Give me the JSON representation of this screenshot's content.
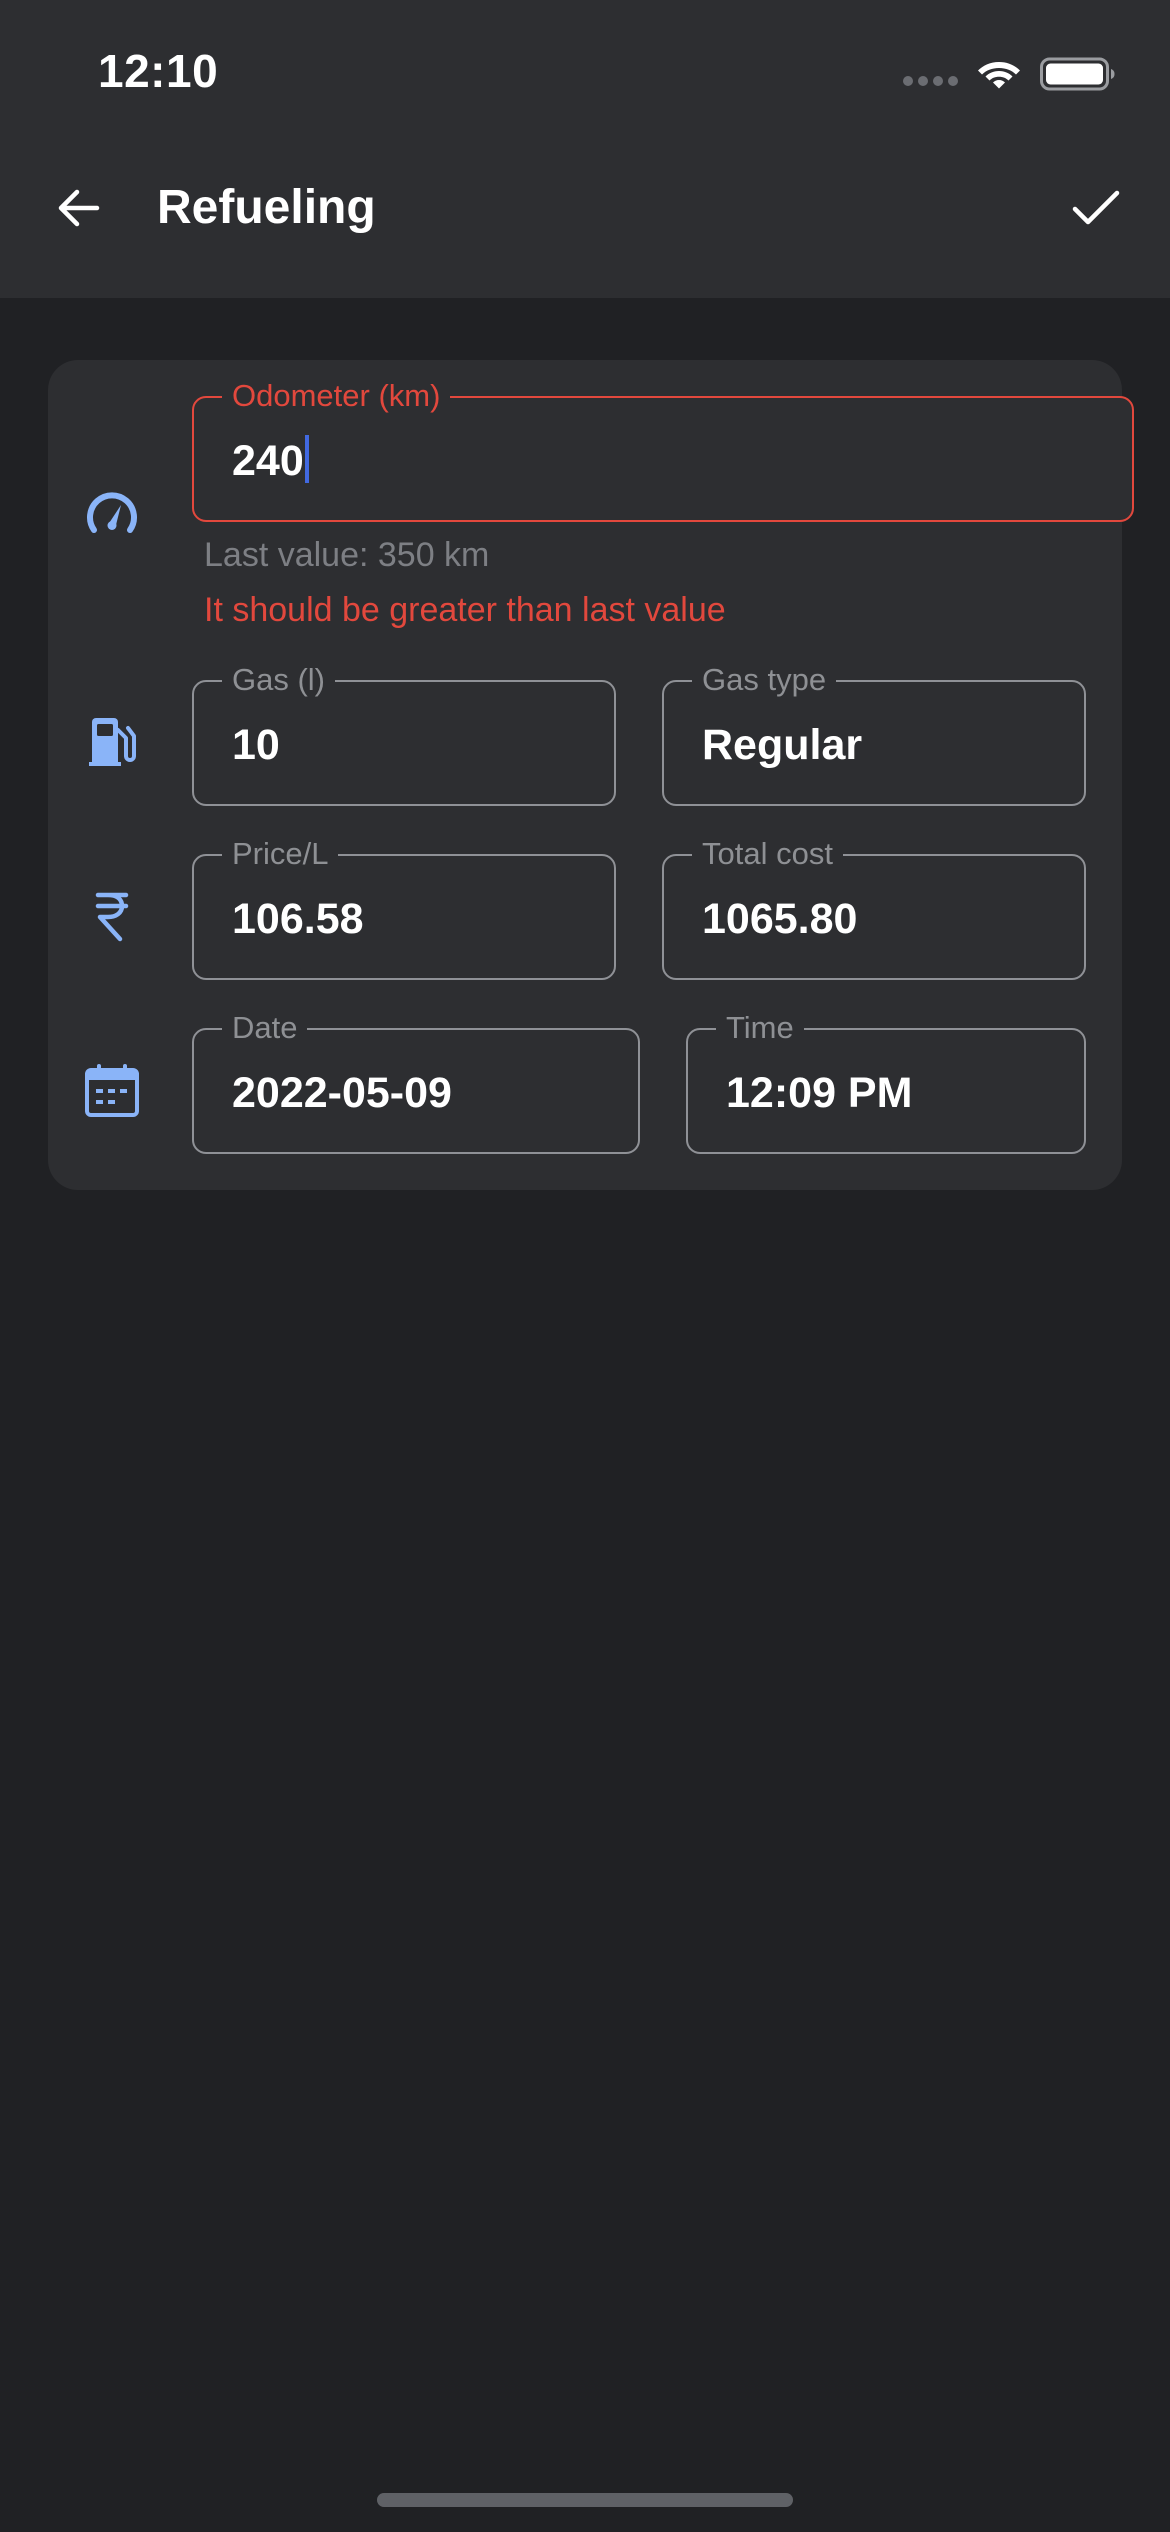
{
  "status_bar": {
    "time": "12:10",
    "icons": [
      "cellular-dots-icon",
      "wifi-icon",
      "battery-icon"
    ]
  },
  "app_bar": {
    "title": "Refueling",
    "back_icon": "arrow-left-icon",
    "save_icon": "check-icon"
  },
  "form": {
    "odometer": {
      "label": "Odometer (km)",
      "value": "240",
      "icon": "speedometer-icon",
      "helper": "Last value: 350 km",
      "error": "It should be greater than last value"
    },
    "gas": {
      "label": "Gas (l)",
      "value": "10",
      "icon": "gas-pump-icon"
    },
    "gas_type": {
      "label": "Gas type",
      "value": "Regular"
    },
    "price": {
      "label": "Price/L",
      "value": "106.58",
      "icon": "rupee-icon"
    },
    "total_cost": {
      "label": "Total cost",
      "value": "1065.80"
    },
    "date": {
      "label": "Date",
      "value": "2022-05-09",
      "icon": "calendar-icon"
    },
    "time": {
      "label": "Time",
      "value": "12:09 PM"
    }
  },
  "colors": {
    "background": "#202124",
    "surface": "#2d2e31",
    "accent_icon": "#8ab4f8",
    "error": "#e2483d",
    "caret": "#4169e1"
  }
}
